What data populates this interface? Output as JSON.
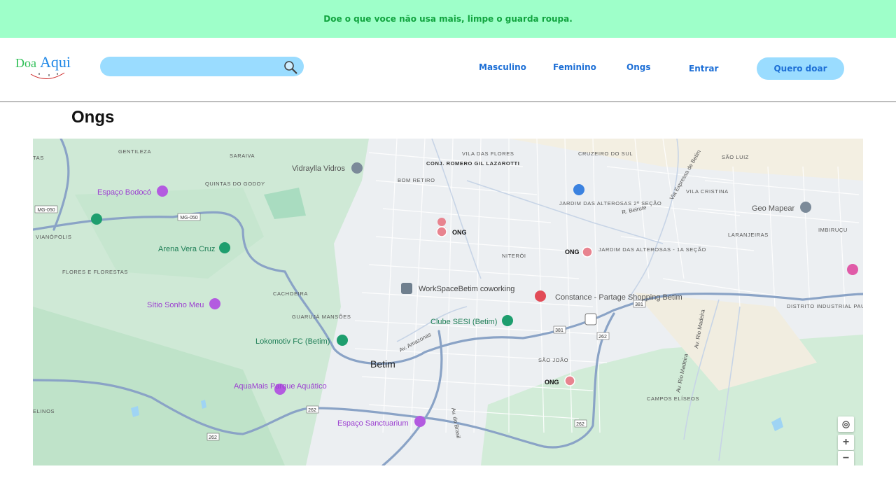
{
  "banner": {
    "text": "Doe o que voce não usa mais, limpe o guarda roupa."
  },
  "logo": {
    "part1": "Doa",
    "part2": "Aqui"
  },
  "search": {
    "placeholder": ""
  },
  "nav": {
    "masculino": "Masculino",
    "feminino": "Feminino",
    "ongs": "Ongs",
    "entrar": "Entrar",
    "cta": "Quero doar"
  },
  "page": {
    "title": "Ongs"
  },
  "colors": {
    "banner_bg": "#9effc9",
    "banner_text": "#11a43f",
    "accent": "#9adcff",
    "link": "#1d6fd6",
    "ong_pin": "#e8838f"
  },
  "map": {
    "markers": [
      {
        "label": "ONG",
        "type": "ong-pin"
      },
      {
        "label": "ONG",
        "type": "ong-pin"
      },
      {
        "label": "ONG",
        "type": "ong-pin"
      }
    ],
    "places": [
      {
        "name": "Vidraylla Vidros",
        "icon": "place-icon"
      },
      {
        "name": "Espaço Bodocó",
        "icon": "leisure-icon"
      },
      {
        "name": "Arena Vera Cruz",
        "icon": "sport-icon"
      },
      {
        "name": "Sítio Sonho Meu",
        "icon": "leisure-icon"
      },
      {
        "name": "WorkSpaceBetim coworking",
        "icon": "office-icon"
      },
      {
        "name": "Constance - Partage Shopping Betim",
        "icon": "shop-icon"
      },
      {
        "name": "Clube SESI (Betim)",
        "icon": "sport-icon"
      },
      {
        "name": "Lokomotiv FC (Betim)",
        "icon": "park-icon"
      },
      {
        "name": "AquaMais Parque Aquático",
        "icon": "park-icon"
      },
      {
        "name": "Espaço Sanctuarium",
        "icon": "leisure-icon"
      },
      {
        "name": "Geo Mapear",
        "icon": "place-icon"
      }
    ],
    "areas": [
      "GENTILEZA",
      "SARAIVA",
      "QUINTAS DO GODOY",
      "VIANÓPOLIS",
      "FLORES E FLORESTAS",
      "CACHOEIRA",
      "GUARUJÁ MANSÕES",
      "CONJ. ROMERO GIL LAZAROTTI",
      "BOM RETIRO",
      "VILA DAS FLORES",
      "CRUZEIRO DO SUL",
      "JARDIM DAS ALTEROSAS 2ª SEÇÃO",
      "NITERÓI",
      "JARDIM DAS ALTEROSAS - 1A SEÇÃO",
      "SÃO LUIZ",
      "VILA CRISTINA",
      "LARANJEIRAS",
      "IMBIRUÇU",
      "DISTRITO INDUSTRIAL PAULO CAMILO SUL",
      "SÃO JOÃO",
      "CAMPOS ELÍSEOS",
      "Betim",
      "TAS",
      "ELINOS"
    ],
    "roads": [
      "MG-050",
      "MG-050",
      "381",
      "381",
      "262",
      "262",
      "262",
      "262",
      "Av. Amazonas",
      "Av. do Brasil",
      "R. Beirute",
      "Via Expressa de Betim",
      "Av. Rio Madeira",
      "Av. Rio Madeira"
    ],
    "controls": {
      "locate": "◎",
      "zoom_in": "+",
      "zoom_out": "−"
    }
  }
}
